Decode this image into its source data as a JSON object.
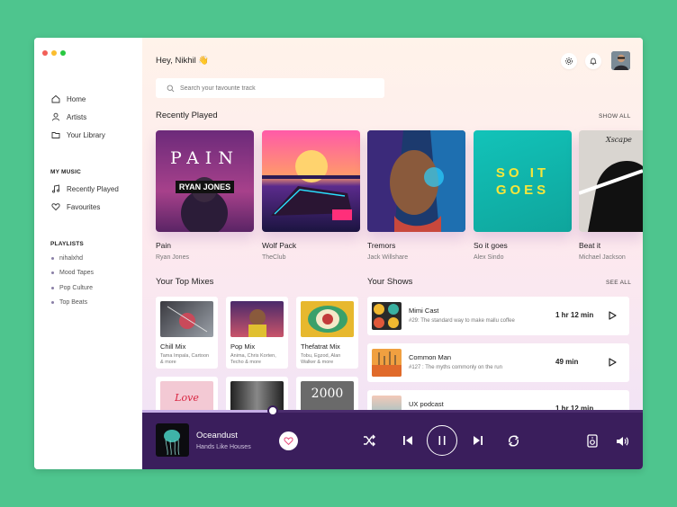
{
  "colors": {
    "background": "#4ec58e",
    "player": "#3a1e5c",
    "accent": "#e84a7a"
  },
  "sidebar": {
    "nav": [
      {
        "label": "Home",
        "icon": "home-icon"
      },
      {
        "label": "Artists",
        "icon": "user-icon"
      },
      {
        "label": "Your Library",
        "icon": "folder-icon"
      }
    ],
    "my_music_title": "MY MUSIC",
    "my_music": [
      {
        "label": "Recently Played",
        "icon": "music-note-icon"
      },
      {
        "label": "Favourites",
        "icon": "heart-icon"
      }
    ],
    "playlists_title": "PLAYLISTS",
    "playlists": [
      "nihalxhd",
      "Mood Tapes",
      "Pop Culture",
      "Top Beats"
    ]
  },
  "header": {
    "greeting": "Hey, Nikhil 👋",
    "search_placeholder": "Search your favourite track"
  },
  "recently_played": {
    "title": "Recently Played",
    "link": "SHOW ALL",
    "items": [
      {
        "title": "Pain",
        "artist": "Ryan Jones",
        "cover_text": "PAIN",
        "cover_sub": "RYAN JONES"
      },
      {
        "title": "Wolf Pack",
        "artist": "TheClub"
      },
      {
        "title": "Tremors",
        "artist": "Jack Willshare"
      },
      {
        "title": "So it goes",
        "artist": "Alex Sindo",
        "cover_text": "SO IT GOES"
      },
      {
        "title": "Beat it",
        "artist": "Michael Jackson",
        "cover_text": "Xscape"
      }
    ]
  },
  "top_mixes": {
    "title": "Your Top Mixes",
    "items": [
      {
        "title": "Chill Mix",
        "desc": "Tama Impala, Cartoon & more"
      },
      {
        "title": "Pop Mix",
        "desc": "Anima, Chris Korten, Techo & more"
      },
      {
        "title": "Thefatrat Mix",
        "desc": "Tobu, Egzod, Alan Walker & more"
      },
      {
        "title": "",
        "desc": "",
        "art_text": "Love"
      },
      {
        "title": "",
        "desc": ""
      },
      {
        "title": "",
        "desc": "",
        "art_text": "2000"
      }
    ]
  },
  "shows": {
    "title": "Your Shows",
    "link": "SEE ALL",
    "items": [
      {
        "title": "Mimi Cast",
        "desc": "#29: The standard way to make mallu coffee",
        "duration": "1 hr 12 min"
      },
      {
        "title": "Common Man",
        "desc": "#127 : The myths commonly on the run",
        "duration": "49 min"
      },
      {
        "title": "UX podcast",
        "desc": "",
        "duration": "1 hr 12 min"
      }
    ]
  },
  "player": {
    "title": "Oceandust",
    "artist": "Hands Like Houses",
    "progress": 0.26
  }
}
